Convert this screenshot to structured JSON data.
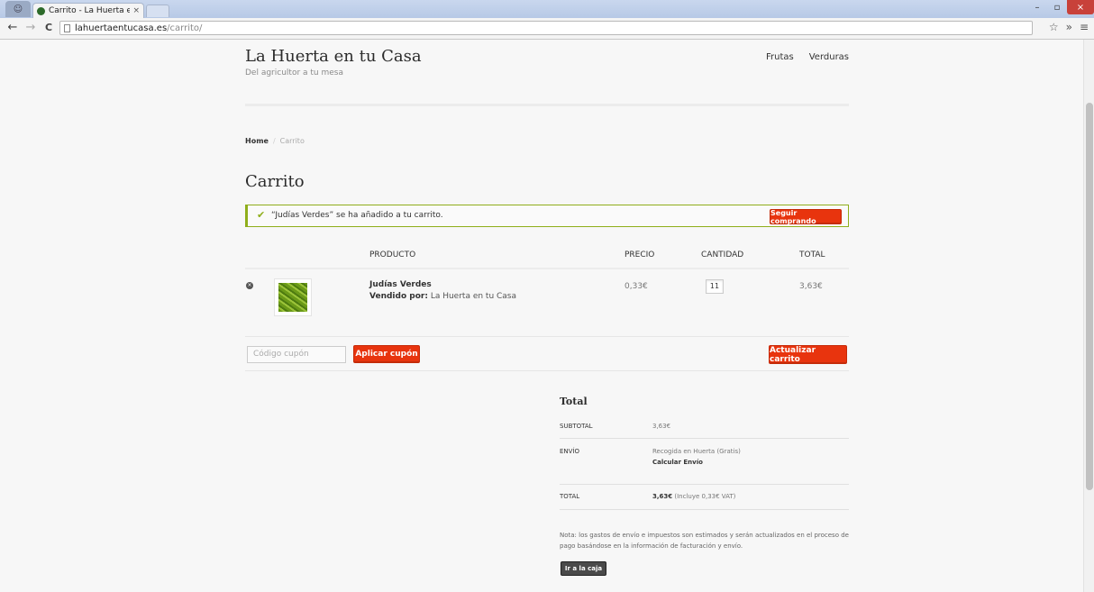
{
  "browser": {
    "tab_title": "Carrito - La Huerta en tu C",
    "tab_close": "×",
    "url_host": "lahuertaentucasa.es",
    "url_path": "/carrito/",
    "back": "←",
    "forward": "→",
    "reload": "C",
    "star": "☆",
    "more": "»",
    "menu": "≡",
    "minimize": "–",
    "restore": "▫",
    "close": "×"
  },
  "site": {
    "title": "La Huerta en tu Casa",
    "tagline": "Del agricultor a tu mesa",
    "nav": [
      "Frutas",
      "Verduras"
    ]
  },
  "breadcrumb": {
    "home": "Home",
    "separator": "/",
    "current": "Carrito"
  },
  "page_title": "Carrito",
  "notice": {
    "message": "“Judías Verdes” se ha añadido a tu carrito.",
    "button": "Seguir comprando",
    "color": "#8fae1b"
  },
  "cart_table": {
    "headers": {
      "product": "PRODUCTO",
      "price": "PRECIO",
      "quantity": "CANTIDAD",
      "total": "TOTAL"
    },
    "rows": [
      {
        "remove": "×",
        "name": "Judías Verdes",
        "sold_by_label": "Vendido por:",
        "sold_by": "La Huerta en tu Casa",
        "price": "0,33€",
        "quantity": "11",
        "total": "3,63€"
      }
    ]
  },
  "coupon": {
    "placeholder": "Código cupón",
    "apply_button": "Aplicar cupón",
    "update_button": "Actualizar carrito"
  },
  "totals": {
    "title": "Total",
    "subtotal_label": "SUBTOTAL",
    "subtotal_value": "3,63€",
    "shipping_label": "ENVÍO",
    "shipping_value": "Recogida en Huerta (Gratis)",
    "shipping_calc": "Calcular Envío",
    "total_label": "TOTAL",
    "total_value": "3,63€",
    "total_note": "(Incluye 0,33€ VAT)"
  },
  "note": "Nota: los gastos de envío e impuestos son estimados y serán actualizados en el proceso de pago basándose en la información de facturación y envío.",
  "checkout_button": "Ir a la caja",
  "colors": {
    "accent": "#e8340e",
    "checkout": "#4a4a4a"
  }
}
